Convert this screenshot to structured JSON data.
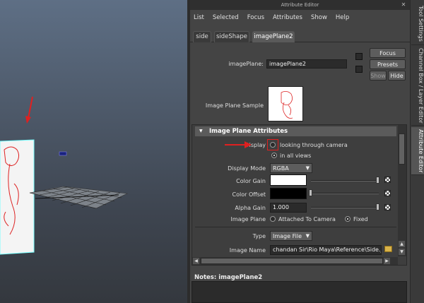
{
  "window": {
    "title": "Attribute Editor",
    "close_glyph": "✕"
  },
  "menu": [
    "List",
    "Selected",
    "Focus",
    "Attributes",
    "Show",
    "Help"
  ],
  "tabs": [
    {
      "label": "side",
      "active": false
    },
    {
      "label": "sideShape",
      "active": false
    },
    {
      "label": "imagePlane2",
      "active": true
    }
  ],
  "node": {
    "label": "imagePlane:",
    "value": "imagePlane2"
  },
  "buttons": {
    "focus": "Focus",
    "presets": "Presets",
    "show": "Show",
    "hide": "Hide"
  },
  "sample": {
    "label": "Image Plane Sample"
  },
  "section": {
    "title": "Image Plane Attributes",
    "toggle": "▼"
  },
  "display": {
    "label": "Display",
    "options": [
      {
        "label": "looking through camera",
        "selected": false
      },
      {
        "label": "in all views",
        "selected": true
      }
    ]
  },
  "display_mode": {
    "label": "Display Mode",
    "value": "RGBA"
  },
  "color_gain": {
    "label": "Color Gain",
    "swatch": "#ffffff"
  },
  "color_offset": {
    "label": "Color Offset",
    "swatch": "#000000"
  },
  "alpha_gain": {
    "label": "Alpha Gain",
    "value": "1.000"
  },
  "image_plane": {
    "label": "Image Plane",
    "options": [
      {
        "label": "Attached To Camera",
        "selected": false
      },
      {
        "label": "Fixed",
        "selected": true
      }
    ]
  },
  "type": {
    "label": "Type",
    "value": "Image File"
  },
  "image_name": {
    "label": "Image Name",
    "value": "chandan Sir\\Rio Maya\\Reference\\Side.jpg"
  },
  "notes": {
    "label": "Notes:",
    "value": "imagePlane2"
  },
  "side_tabs": [
    {
      "label": "Tool Settings",
      "active": false
    },
    {
      "label": "Channel Box / Layer Editor",
      "active": false
    },
    {
      "label": "Attribute Editor",
      "active": true
    }
  ],
  "colors": {
    "annotation": "#e02020",
    "panel": "#444444",
    "header": "#5b5b5b"
  }
}
